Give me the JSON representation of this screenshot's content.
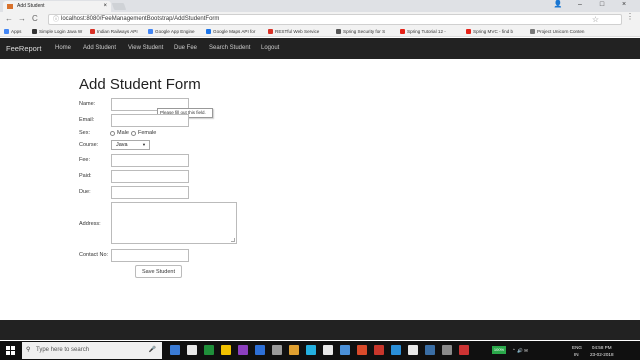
{
  "browser": {
    "tab_title": "Add Student",
    "tab_close": "×",
    "url": "localhost:8080/FeeManagementBootstrap/AddStudentForm",
    "window_controls": {
      "user": "👤",
      "minimize": "–",
      "maximize": "□",
      "close": "×"
    },
    "nav": {
      "back": "←",
      "forward": "→",
      "reload": "C",
      "star": "☆",
      "menu": "⋮"
    },
    "bookmarks": [
      {
        "label": "Apps",
        "color": "#4285f4"
      },
      {
        "label": "Simple Login Java W",
        "color": "#333333"
      },
      {
        "label": "Indian Railways API",
        "color": "#d93025"
      },
      {
        "label": "Google App Engine",
        "color": "#4285f4"
      },
      {
        "label": "Google Maps API for",
        "color": "#1a73e8"
      },
      {
        "label": "RESTful Web Service",
        "color": "#d93025"
      },
      {
        "label": "Spring Security for S",
        "color": "#555555"
      },
      {
        "label": "Spring Tutorial 12 -",
        "color": "#e62117"
      },
      {
        "label": "Spring MVC - find b",
        "color": "#e62117"
      },
      {
        "label": "Project Unicorn Conten",
        "color": "#777777"
      }
    ]
  },
  "app_nav": {
    "brand": "FeeReport",
    "links": [
      "Home",
      "Add Student",
      "View Student",
      "Due Fee",
      "Search Student",
      "Logout"
    ]
  },
  "form": {
    "title": "Add Student Form",
    "labels": {
      "name": "Name:",
      "email": "Email:",
      "sex": "Sex:",
      "course": "Course:",
      "fee": "Fee:",
      "paid": "Paid:",
      "due": "Due:",
      "address": "Address:",
      "contact": "Contact No:"
    },
    "sex_options": [
      "Male",
      "Female"
    ],
    "course_selected": "Java",
    "tooltip": "Please fill out this field.",
    "submit_label": "Save Student"
  },
  "taskbar": {
    "search_placeholder": "Type here to search",
    "search_icon": "⚲",
    "mic_icon": "🎤",
    "battery": "100%",
    "language": "ENG",
    "region": "IN",
    "time": "04:58 PM",
    "date": "23-02-2018",
    "tray_icons": "⌃ 🔊 ✉",
    "pinned_app_colors": [
      "#3a7bd5",
      "#e8e8e8",
      "#1f8f3a",
      "#f2c200",
      "#8c3fbf",
      "#2d6fd6",
      "#9a9a9a",
      "#e0a030",
      "#24b0e0",
      "#e8e8e8",
      "#4a90d9",
      "#d94a2a",
      "#c8362b",
      "#2a8fd9",
      "#e8e8e8",
      "#3a6ea5",
      "#8a8a8a",
      "#cc3333"
    ]
  }
}
